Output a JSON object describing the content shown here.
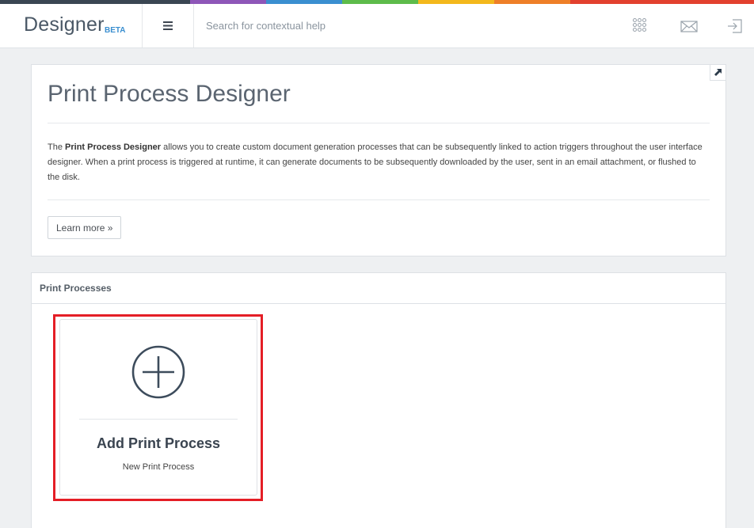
{
  "brand": {
    "name": "Designer",
    "badge": "BETA"
  },
  "search": {
    "placeholder": "Search for contextual help"
  },
  "color_bar": [
    "#3a4652",
    "#8e56b8",
    "#3a8fd0",
    "#5dbb4a",
    "#f3b81c",
    "#ee7f28",
    "#e2402e"
  ],
  "icons": {
    "menu": "hamburger-icon",
    "apps": "grid-dots-icon",
    "mail": "envelope-icon",
    "logout": "sign-out-icon",
    "expand": "expand-arrow-icon",
    "add": "plus-circle-icon"
  },
  "intro": {
    "title": "Print Process Designer",
    "desc_pre": "The ",
    "desc_bold": "Print Process Designer",
    "desc_post": " allows you to create custom document generation processes that can be subsequently linked to action triggers throughout the user interface designer. When a print process is triggered at runtime, it can generate documents to be subsequently downloaded by the user, sent in an email attachment, or flushed to the disk.",
    "learn_more": "Learn more »"
  },
  "processes": {
    "title": "Print Processes",
    "add_card": {
      "title": "Add Print Process",
      "subtitle": "New Print Process"
    }
  },
  "colors": {
    "highlight": "#e41e26",
    "accent": "#3a8fd0",
    "icon": "#3d4c5c"
  }
}
